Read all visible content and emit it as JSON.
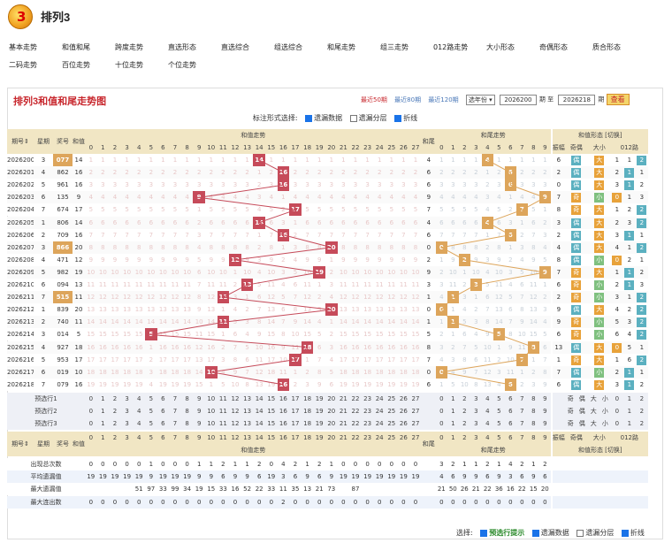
{
  "header": {
    "title": "排列3",
    "logo_text": "3"
  },
  "nav": [
    "基本走势",
    "和值和尾",
    "跨度走势",
    "直选形态",
    "直选综合",
    "组选综合",
    "和尾走势",
    "组三走势",
    "012路走势",
    "大小形态",
    "奇偶形态",
    "质合形态",
    "二码走势",
    "百位走势",
    "十位走势",
    "个位走势"
  ],
  "chart": {
    "title": "排列3和值和尾走势图",
    "recent50": "最近50期",
    "recent80": "最近80期",
    "recent120": "最近120期",
    "year_sel": "选年份",
    "from": "2026200",
    "to": "2026218",
    "lbl_from": "期",
    "lbl_to": "至",
    "lbl_to2": "期",
    "query": "查看"
  },
  "options": {
    "label": "标注形式选择:",
    "o1": "遗漏数据",
    "o2": "遗漏分层",
    "o3": "折线"
  },
  "head": {
    "issue": "期号",
    "week": "星期",
    "prize": "奖号",
    "sum": "和值",
    "sumtrend": "和值走势",
    "tail": "和尾",
    "tailtrend": "和尾走势",
    "shape": "和值形态",
    "shape_link": "[切换]",
    "ampl": "振幅",
    "oe": "奇偶",
    "bs": "大小",
    "r012": "012路",
    "odd": "奇",
    "even": "偶",
    "big": "大",
    "small": "小",
    "r0": "0",
    "r1": "1",
    "r2": "2"
  },
  "rows": [
    {
      "i": "2026200",
      "w": "3",
      "p": "077",
      "s": 14,
      "hl": true
    },
    {
      "i": "2026201",
      "w": "4",
      "p": "862",
      "s": 16
    },
    {
      "i": "2026202",
      "w": "5",
      "p": "961",
      "s": 16
    },
    {
      "i": "2026203",
      "w": "6",
      "p": "135",
      "s": 9
    },
    {
      "i": "2026204",
      "w": "7",
      "p": "674",
      "s": 17
    },
    {
      "i": "2026205",
      "w": "1",
      "p": "806",
      "s": 14
    },
    {
      "i": "2026206",
      "w": "2",
      "p": "709",
      "s": 16
    },
    {
      "i": "2026207",
      "w": "3",
      "p": "866",
      "s": 20,
      "hl": true
    },
    {
      "i": "2026208",
      "w": "4",
      "p": "471",
      "s": 12
    },
    {
      "i": "2026209",
      "w": "5",
      "p": "982",
      "s": 19
    },
    {
      "i": "2026210",
      "w": "6",
      "p": "094",
      "s": 13
    },
    {
      "i": "2026211",
      "w": "7",
      "p": "515",
      "s": 11,
      "hl": true
    },
    {
      "i": "2026212",
      "w": "1",
      "p": "839",
      "s": 20
    },
    {
      "i": "2026213",
      "w": "2",
      "p": "740",
      "s": 11
    },
    {
      "i": "2026214",
      "w": "3",
      "p": "014",
      "s": 5
    },
    {
      "i": "2026215",
      "w": "4",
      "p": "927",
      "s": 18
    },
    {
      "i": "2026216",
      "w": "5",
      "p": "953",
      "s": 17
    },
    {
      "i": "2026217",
      "w": "6",
      "p": "019",
      "s": 10
    },
    {
      "i": "2026218",
      "w": "7",
      "p": "079",
      "s": 16
    }
  ],
  "pred": [
    "预选行1",
    "预选行2",
    "预选行3"
  ],
  "stats": [
    {
      "label": "出现总次数",
      "sum": [
        "0",
        "0",
        "0",
        "0",
        "0",
        "1",
        "0",
        "0",
        "0",
        "1",
        "1",
        "2",
        "1",
        "1",
        "2",
        "0",
        "4",
        "2",
        "1",
        "2",
        "1",
        "0",
        "0",
        "0",
        "0",
        "0",
        "0",
        "0"
      ],
      "tail": [
        "3",
        "2",
        "1",
        "1",
        "2",
        "1",
        "4",
        "2",
        "1",
        "2"
      ]
    },
    {
      "label": "平均遗漏值",
      "sum": [
        "19",
        "19",
        "19",
        "19",
        "19",
        "9",
        "19",
        "19",
        "19",
        "9",
        "9",
        "6",
        "9",
        "9",
        "6",
        "19",
        "3",
        "6",
        "9",
        "6",
        "9",
        "19",
        "19",
        "19",
        "19",
        "19",
        "19",
        "19"
      ],
      "tail": [
        "4",
        "6",
        "9",
        "9",
        "6",
        "9",
        "3",
        "6",
        "9",
        "6"
      ]
    },
    {
      "label": "最大遗漏值",
      "sum": [
        "",
        "",
        "",
        "",
        "51",
        "97",
        "33",
        "99",
        "34",
        "19",
        "15",
        "33",
        "16",
        "52",
        "22",
        "33",
        "11",
        "35",
        "13",
        "21",
        "73",
        "",
        "87",
        "",
        "",
        "",
        "",
        ""
      ],
      "tail": [
        "21",
        "50",
        "26",
        "21",
        "22",
        "36",
        "16",
        "22",
        "15",
        "20"
      ]
    },
    {
      "label": "最大连出数",
      "sum": [
        "0",
        "0",
        "0",
        "0",
        "0",
        "0",
        "0",
        "0",
        "0",
        "0",
        "0",
        "0",
        "0",
        "0",
        "0",
        "0",
        "2",
        "0",
        "0",
        "0",
        "0",
        "0",
        "0",
        "0",
        "0",
        "0",
        "0",
        "0"
      ],
      "tail": [
        "0",
        "0",
        "0",
        "0",
        "0",
        "0",
        "0",
        "0",
        "0",
        "0"
      ]
    }
  ],
  "footer": {
    "label": "选择:",
    "f1": "预选行提示",
    "f2": "遗漏数据",
    "f3": "遗漏分层",
    "f4": "折线"
  },
  "colors": {
    "sum_hit": "#c64b5a",
    "tail_hit": "#dda55b",
    "odd": "#e8a23a",
    "even": "#5bb0c0",
    "big": "#e8a23a",
    "small": "#7fc07f",
    "r0": "#e8a23a",
    "r1": "#5bb0c0",
    "r2": "#5bb0c0"
  }
}
